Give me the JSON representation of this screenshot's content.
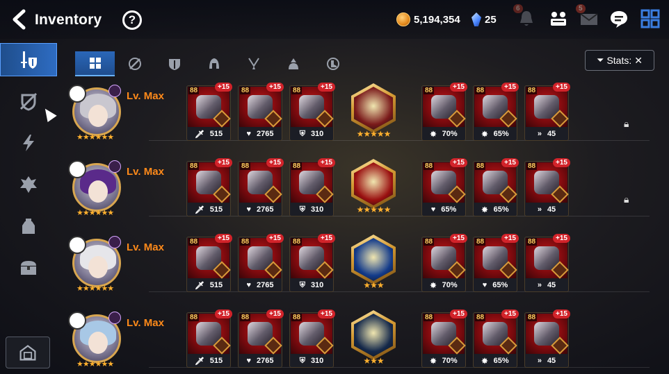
{
  "header": {
    "title": "Inventory",
    "help_label": "?",
    "gold": "5,194,354",
    "crystals": "25",
    "bell_badge": "6",
    "mail_badge": "5"
  },
  "tabs": [
    "all",
    "weapon",
    "armor",
    "helmet",
    "necklace",
    "ring",
    "boots"
  ],
  "stats_button": "Stats:",
  "heroes": [
    {
      "level": "Lv. Max",
      "hair_color": "#c9c7cf",
      "artifact_color": "#7a1a1a",
      "artifact_stars": "★★★★★",
      "gear": [
        {
          "ilvl": "88",
          "enh": "+15",
          "stat_icon": "🗡",
          "stat": "515"
        },
        {
          "ilvl": "88",
          "enh": "+15",
          "stat_icon": "♥",
          "stat": "2765"
        },
        {
          "ilvl": "88",
          "enh": "+15",
          "stat_icon": "⛨",
          "stat": "310"
        },
        {
          "ilvl": "88",
          "enh": "+15",
          "stat_icon": "✸",
          "stat": "70%"
        },
        {
          "ilvl": "88",
          "enh": "+15",
          "stat_icon": "✸",
          "stat": "65%"
        },
        {
          "ilvl": "88",
          "enh": "+15",
          "stat_icon": "»",
          "stat": "45"
        }
      ]
    },
    {
      "level": "Lv. Max",
      "hair_color": "#5a2a8a",
      "artifact_color": "#9a1010",
      "artifact_stars": "★★★★★",
      "gear": [
        {
          "ilvl": "88",
          "enh": "+15",
          "stat_icon": "🗡",
          "stat": "515"
        },
        {
          "ilvl": "88",
          "enh": "+15",
          "stat_icon": "♥",
          "stat": "2765"
        },
        {
          "ilvl": "88",
          "enh": "+15",
          "stat_icon": "⛨",
          "stat": "310"
        },
        {
          "ilvl": "88",
          "enh": "+15",
          "stat_icon": "♥",
          "stat": "65%"
        },
        {
          "ilvl": "88",
          "enh": "+15",
          "stat_icon": "✸",
          "stat": "65%"
        },
        {
          "ilvl": "88",
          "enh": "+15",
          "stat_icon": "»",
          "stat": "45"
        }
      ]
    },
    {
      "level": "Lv. Max",
      "hair_color": "#e6e6ea",
      "artifact_color": "#123a8a",
      "artifact_stars": "★★★",
      "gear": [
        {
          "ilvl": "88",
          "enh": "+15",
          "stat_icon": "🗡",
          "stat": "515"
        },
        {
          "ilvl": "88",
          "enh": "+15",
          "stat_icon": "♥",
          "stat": "2765"
        },
        {
          "ilvl": "88",
          "enh": "+15",
          "stat_icon": "⛨",
          "stat": "310"
        },
        {
          "ilvl": "88",
          "enh": "+15",
          "stat_icon": "✸",
          "stat": "70%"
        },
        {
          "ilvl": "88",
          "enh": "+15",
          "stat_icon": "♥",
          "stat": "65%"
        },
        {
          "ilvl": "88",
          "enh": "+15",
          "stat_icon": "»",
          "stat": "45"
        }
      ]
    },
    {
      "level": "Lv. Max",
      "hair_color": "#a8c8e6",
      "artifact_color": "#14284a",
      "artifact_stars": "★★★",
      "gear": [
        {
          "ilvl": "88",
          "enh": "+15",
          "stat_icon": "🗡",
          "stat": "515"
        },
        {
          "ilvl": "88",
          "enh": "+15",
          "stat_icon": "♥",
          "stat": "2765"
        },
        {
          "ilvl": "88",
          "enh": "+15",
          "stat_icon": "⛨",
          "stat": "310"
        },
        {
          "ilvl": "88",
          "enh": "+15",
          "stat_icon": "✸",
          "stat": "70%"
        },
        {
          "ilvl": "88",
          "enh": "+15",
          "stat_icon": "✸",
          "stat": "65%"
        },
        {
          "ilvl": "88",
          "enh": "+15",
          "stat_icon": "»",
          "stat": "45"
        }
      ]
    }
  ]
}
